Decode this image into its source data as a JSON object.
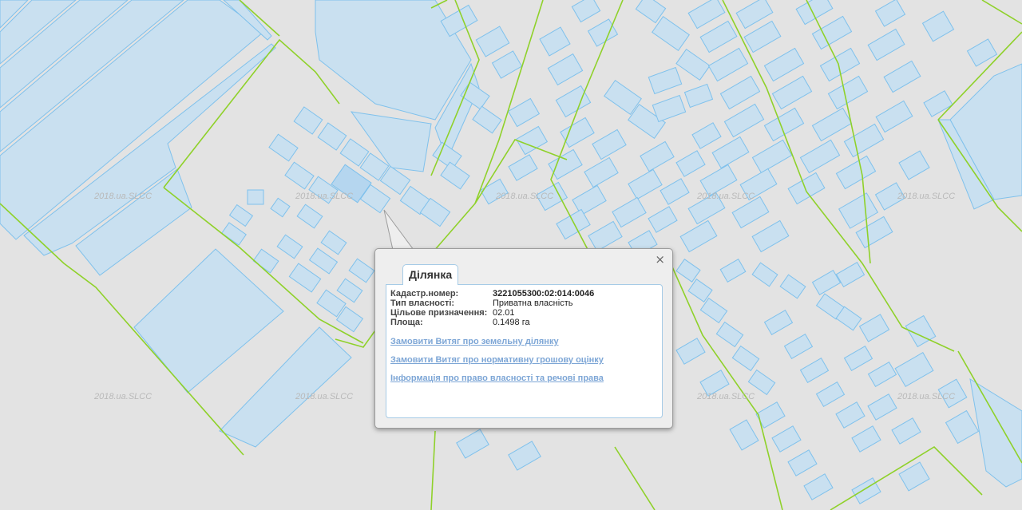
{
  "map": {
    "watermark_text": "2018.ua.SLCC",
    "parcel_fill": "#c9e0f0",
    "parcel_stroke": "#7fc1ec",
    "boundary_color": "#8fd12a",
    "background": "#e3e3e3"
  },
  "popup": {
    "tab_label": "Ділянка",
    "close_icon": "×",
    "fields": [
      {
        "label": "Кадастр.номер:",
        "value": "3221055300:02:014:0046"
      },
      {
        "label": "Тип власності:",
        "value": "Приватна власність"
      },
      {
        "label": "Цільове призначення:",
        "value": "02.01"
      },
      {
        "label": "Площа:",
        "value": "0.1498 га"
      }
    ],
    "links": [
      "Замовити Витяг про земельну ділянку",
      "Замовити Витяг про нормативну грошову оцінку",
      "Інформація про право власності та речові права"
    ]
  }
}
